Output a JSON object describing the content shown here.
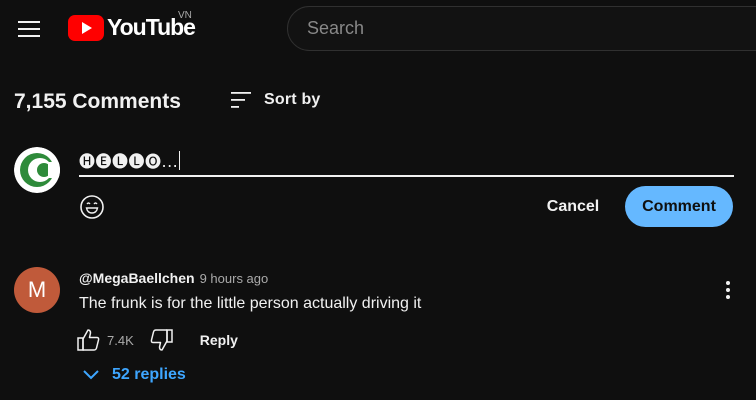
{
  "header": {
    "logo_text": "YouTube",
    "region": "VN",
    "search_placeholder": "Search"
  },
  "comments": {
    "count_label": "7,155 Comments",
    "sort_label": "Sort by"
  },
  "composer": {
    "input_value": "🅗🅔🅛🅛🅞...",
    "cancel_label": "Cancel",
    "submit_label": "Comment",
    "submit_color": "#65b8ff"
  },
  "comment_list": [
    {
      "avatar_letter": "M",
      "avatar_color": "#c05a3a",
      "author": "@MegaBaellchen",
      "time": "9 hours ago",
      "text": "The frunk is for the little person actually driving it",
      "like_count": "7.4K",
      "reply_label": "Reply",
      "replies_label": "52 replies"
    }
  ],
  "colors": {
    "background": "#0f0f0f",
    "brand_red": "#ff0000",
    "link_blue": "#3ea6ff"
  },
  "icons": {
    "menu": "hamburger-icon",
    "sort": "sort-lines-icon",
    "emoji": "smiley-icon",
    "like": "thumbs-up-icon",
    "dislike": "thumbs-down-icon",
    "more": "vertical-dots-icon",
    "expand": "chevron-down-icon"
  }
}
